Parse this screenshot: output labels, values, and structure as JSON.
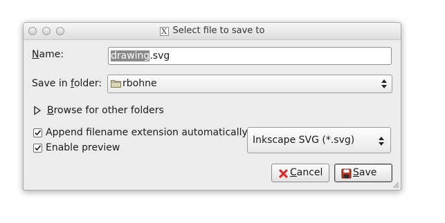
{
  "window": {
    "title": "Select file to save to",
    "x_icon": "X"
  },
  "name_field": {
    "label_prefix": "",
    "label_mnemonic": "N",
    "label_rest": "ame:",
    "value_selected": "drawing",
    "value_rest": ".svg"
  },
  "folder": {
    "label_prefix": "Save in ",
    "label_mnemonic": "f",
    "label_rest": "older:",
    "value": "rbohne",
    "icon": "folder-icon"
  },
  "browse": {
    "label_mnemonic": "B",
    "label_rest": "rowse for other folders",
    "icon": "expander-triangle-icon"
  },
  "options": {
    "append_extension": {
      "label": "Append filename extension automatically",
      "checked": true
    },
    "enable_preview": {
      "label": "Enable preview",
      "checked": true
    }
  },
  "file_type": {
    "value": "Inkscape SVG (*.svg)"
  },
  "buttons": {
    "cancel": {
      "mnemonic": "C",
      "rest": "ancel",
      "icon": "cancel-x-icon"
    },
    "save": {
      "mnemonic": "S",
      "rest": "ave",
      "icon": "floppy-disk-icon"
    }
  },
  "colors": {
    "selection": "#8a8a8a",
    "cancel_icon": "#d03030",
    "save_icon": "#c0392b"
  }
}
